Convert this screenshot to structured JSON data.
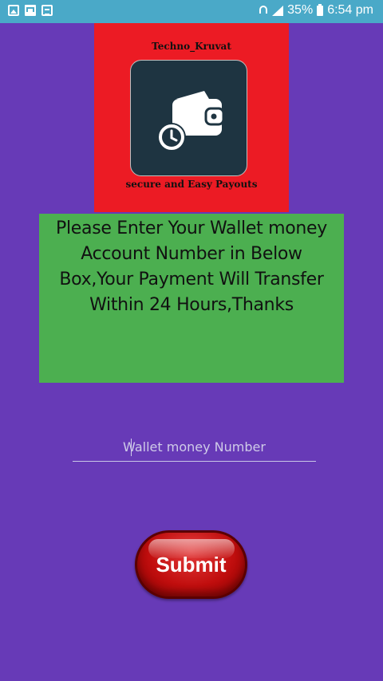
{
  "status_bar": {
    "battery_percent": "35%",
    "time": "6:54 pm",
    "left_icons": [
      "image-icon",
      "mail-icon",
      "calendar-icon"
    ],
    "right_icons": [
      "wifi-icon",
      "signal-icon",
      "battery-icon"
    ]
  },
  "logo": {
    "title": "Techno_Kruvat",
    "tagline": "secure and Easy Payouts",
    "icon": "wallet-icon",
    "background_color": "#ec1b24",
    "tile_color": "#1e3441"
  },
  "message": {
    "text": "Please Enter Your Wallet money Account Number in Below Box,Your Payment Will Transfer Within 24 Hours,Thanks",
    "background_color": "#4caf50"
  },
  "wallet_input": {
    "placeholder": "Wallet money Number",
    "value": ""
  },
  "submit": {
    "label": "Submit",
    "color": "#c10e0e"
  },
  "page": {
    "background_color": "#673ab7"
  }
}
